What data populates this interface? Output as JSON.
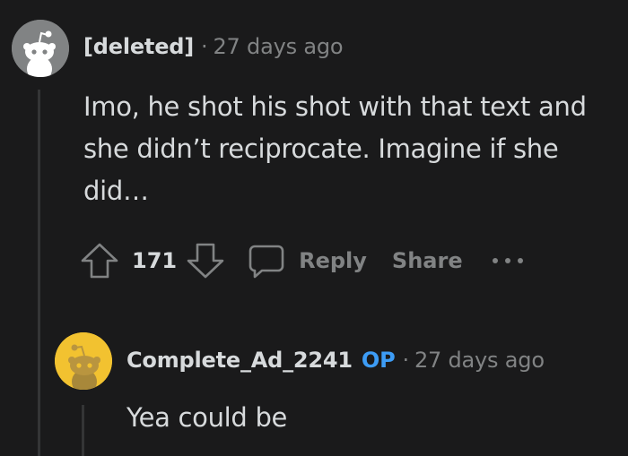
{
  "comments": [
    {
      "author": "[deleted]",
      "separator": "·",
      "time": "27 days ago",
      "body": "Imo, he shot his shot with that text and she didn’t reciprocate. Imagine if she did…",
      "score": "171",
      "actions": {
        "reply": "Reply",
        "share": "Share"
      },
      "avatar_color": "#818384"
    },
    {
      "author": "Complete_Ad_2241",
      "badge": "OP",
      "separator": "·",
      "time": "27 days ago",
      "body": "Yea could be",
      "avatar_color": "#f2c230"
    }
  ],
  "colors": {
    "background": "#1a1a1b",
    "text": "#d7dadc",
    "muted": "#818384",
    "op_badge": "#3d9cf5",
    "thread_line": "#343536"
  },
  "icons": [
    "snoo-avatar-icon",
    "upvote-arrow-icon",
    "downvote-arrow-icon",
    "comment-bubble-icon",
    "more-options-icon"
  ]
}
